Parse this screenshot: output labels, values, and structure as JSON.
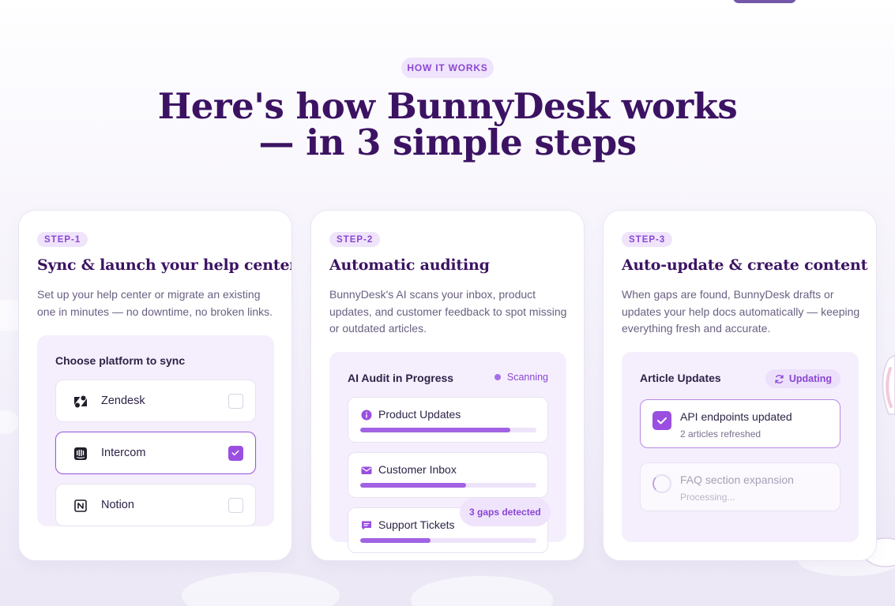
{
  "section_badge": "HOW IT WORKS",
  "headline": {
    "line1": "Here's how BunnyDesk works",
    "line2": "— in 3 simple steps"
  },
  "steps": [
    {
      "step": "STEP-1",
      "title": "Sync & launch your help center",
      "description": "Set up your help center or migrate an existing one in minutes — no downtime, no broken links.",
      "panel": {
        "title": "Choose platform to sync",
        "platforms": [
          {
            "name": "Zendesk",
            "icon": "zendesk-icon",
            "checked": false
          },
          {
            "name": "Intercom",
            "icon": "intercom-icon",
            "checked": true
          },
          {
            "name": "Notion",
            "icon": "notion-icon",
            "checked": false
          }
        ]
      }
    },
    {
      "step": "STEP-2",
      "title": "Automatic auditing",
      "description": "BunnyDesk's AI scans your inbox, product updates, and customer feedback to spot missing or outdated articles.",
      "panel": {
        "title": "AI Audit in Progress",
        "status": "Scanning",
        "items": [
          {
            "label": "Product Updates",
            "icon": "info-icon",
            "progress": 0.85
          },
          {
            "label": "Customer Inbox",
            "icon": "mail-icon",
            "progress": 0.6
          },
          {
            "label": "Support Tickets",
            "icon": "chat-icon",
            "progress": 0.4
          }
        ],
        "gaps_badge": "3 gaps detected"
      }
    },
    {
      "step": "STEP-3",
      "title": "Auto-update & create content",
      "description": "When gaps are found, BunnyDesk drafts or updates your help docs automatically — keeping everything fresh and accurate.",
      "panel": {
        "title": "Article Updates",
        "status": "Updating",
        "items": [
          {
            "title": "API endpoints updated",
            "subtitle": "2 articles refreshed",
            "state": "done"
          },
          {
            "title": "FAQ section expansion",
            "subtitle": "Processing...",
            "state": "pending"
          }
        ]
      }
    }
  ],
  "colors": {
    "accent": "#9a4fe0",
    "heading": "#3c1363",
    "pill_bg": "#efe4fb",
    "pill_text": "#8a46d4",
    "panel_bg": "#f5effd"
  }
}
